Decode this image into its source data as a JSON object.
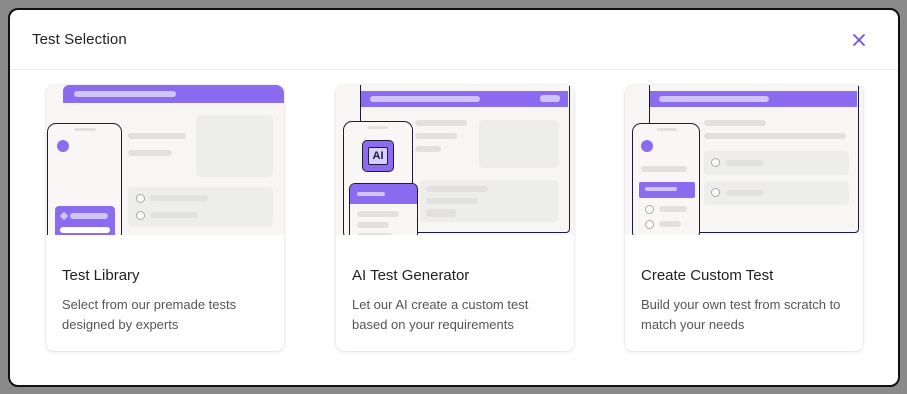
{
  "modal": {
    "title": "Test Selection"
  },
  "icons": {
    "close": "close-icon"
  },
  "colors": {
    "accent": "#8b6cf0",
    "close_icon": "#6a4ff0"
  },
  "cards": [
    {
      "title": "Test Library",
      "description": "Select from our premade tests designed by experts"
    },
    {
      "title": "AI Test Generator",
      "description": "Let our AI create a custom test based on your requirements",
      "badge": "AI"
    },
    {
      "title": "Create Custom Test",
      "description": "Build your own test from scratch to match your needs"
    }
  ]
}
